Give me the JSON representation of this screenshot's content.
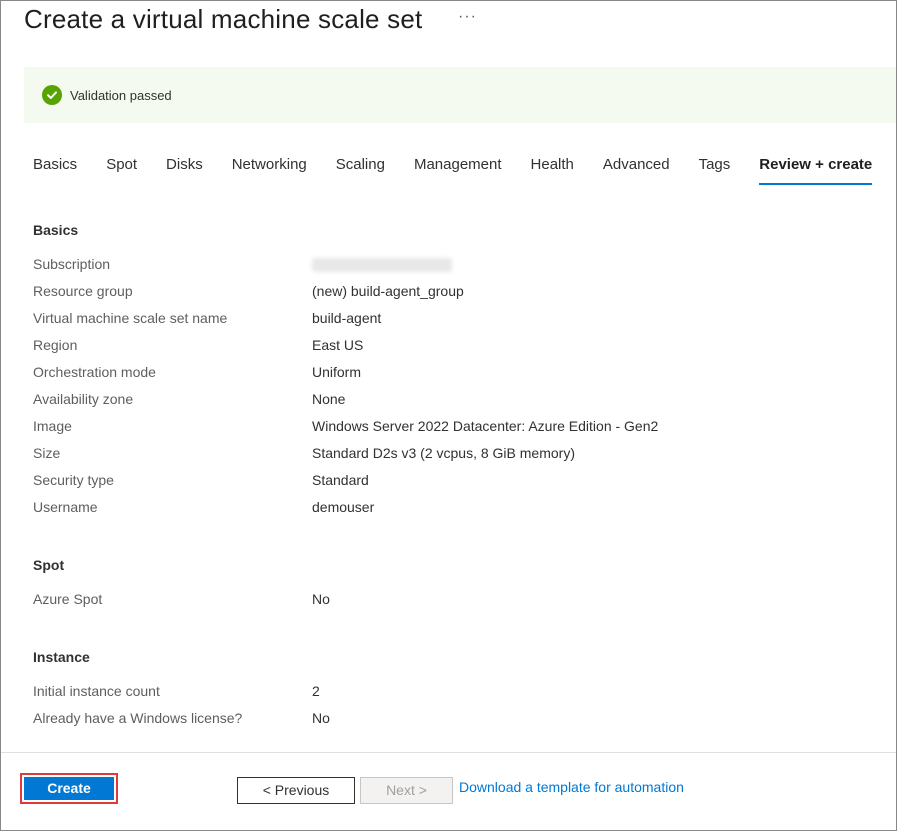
{
  "page": {
    "title": "Create a virtual machine scale set",
    "more_glyph": "···"
  },
  "banner": {
    "text": "Validation passed",
    "icon": "check-circle-icon",
    "color": "#57a300"
  },
  "tabs": [
    "Basics",
    "Spot",
    "Disks",
    "Networking",
    "Scaling",
    "Management",
    "Health",
    "Advanced",
    "Tags",
    "Review + create"
  ],
  "active_tab": "Review + create",
  "sections": {
    "basics": {
      "title": "Basics",
      "rows": [
        {
          "label": "Subscription",
          "value": ""
        },
        {
          "label": "Resource group",
          "value": "(new) build-agent_group"
        },
        {
          "label": "Virtual machine scale set name",
          "value": "build-agent"
        },
        {
          "label": "Region",
          "value": "East US"
        },
        {
          "label": "Orchestration mode",
          "value": "Uniform"
        },
        {
          "label": "Availability zone",
          "value": "None"
        },
        {
          "label": "Image",
          "value": "Windows Server 2022 Datacenter: Azure Edition - Gen2"
        },
        {
          "label": "Size",
          "value": "Standard D2s v3 (2 vcpus, 8 GiB memory)"
        },
        {
          "label": "Security type",
          "value": "Standard"
        },
        {
          "label": "Username",
          "value": "demouser"
        }
      ]
    },
    "spot": {
      "title": "Spot",
      "rows": [
        {
          "label": "Azure Spot",
          "value": "No"
        }
      ]
    },
    "instance": {
      "title": "Instance",
      "rows": [
        {
          "label": "Initial instance count",
          "value": "2"
        },
        {
          "label": "Already have a Windows license?",
          "value": "No"
        }
      ]
    }
  },
  "footer": {
    "create_label": "Create",
    "previous_label": "< Previous",
    "next_label": "Next >",
    "template_link": "Download a template for automation"
  },
  "colors": {
    "accent": "#0078d4",
    "highlight_outline": "#e03a3a",
    "banner_bg": "#f4faf0"
  }
}
